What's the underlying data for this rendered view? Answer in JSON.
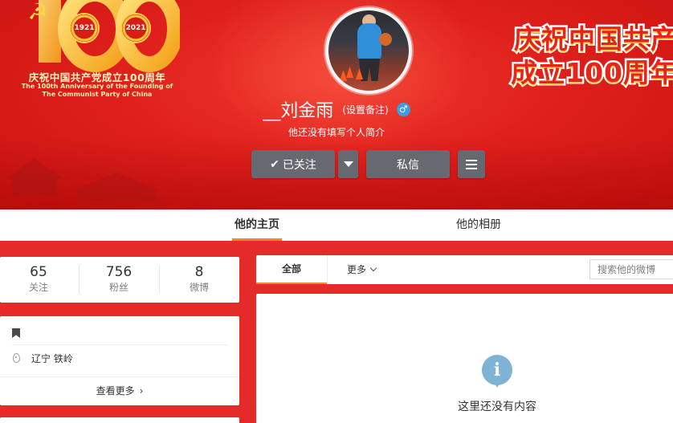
{
  "banner": {
    "emblem": {
      "year_left": "1921",
      "year_right": "2021",
      "title_cn": "庆祝中国共产党成立100周年",
      "title_en_line1": "The 100th Anniversary of the Founding of",
      "title_en_line2": "The Communist Party of China"
    },
    "slogan_line1": "庆祝中国共产",
    "slogan_line2": "成立100周年",
    "colors": {
      "banner_red": "#e52a2a",
      "slogan_red": "#e8231c",
      "gold": "#f8cf52"
    }
  },
  "profile": {
    "nickname": "__刘金雨",
    "remark_link": "(设置备注)",
    "gender_icon": "male-icon",
    "bio": "他还没有填写个人简介"
  },
  "actions": {
    "follow_label": "已关注",
    "message_label": "私信"
  },
  "tabs": {
    "home": "他的主页",
    "album": "他的相册",
    "accent": "#fa7d3c"
  },
  "stats": [
    {
      "value": "65",
      "label": "关注"
    },
    {
      "value": "756",
      "label": "粉丝"
    },
    {
      "value": "8",
      "label": "微博"
    }
  ],
  "info": {
    "location": "辽宁 铁岭",
    "more_label": "查看更多"
  },
  "feed": {
    "tab_all": "全部",
    "tab_more": "更多",
    "search_placeholder": "搜索他的微博",
    "empty_message": "这里还没有内容"
  }
}
